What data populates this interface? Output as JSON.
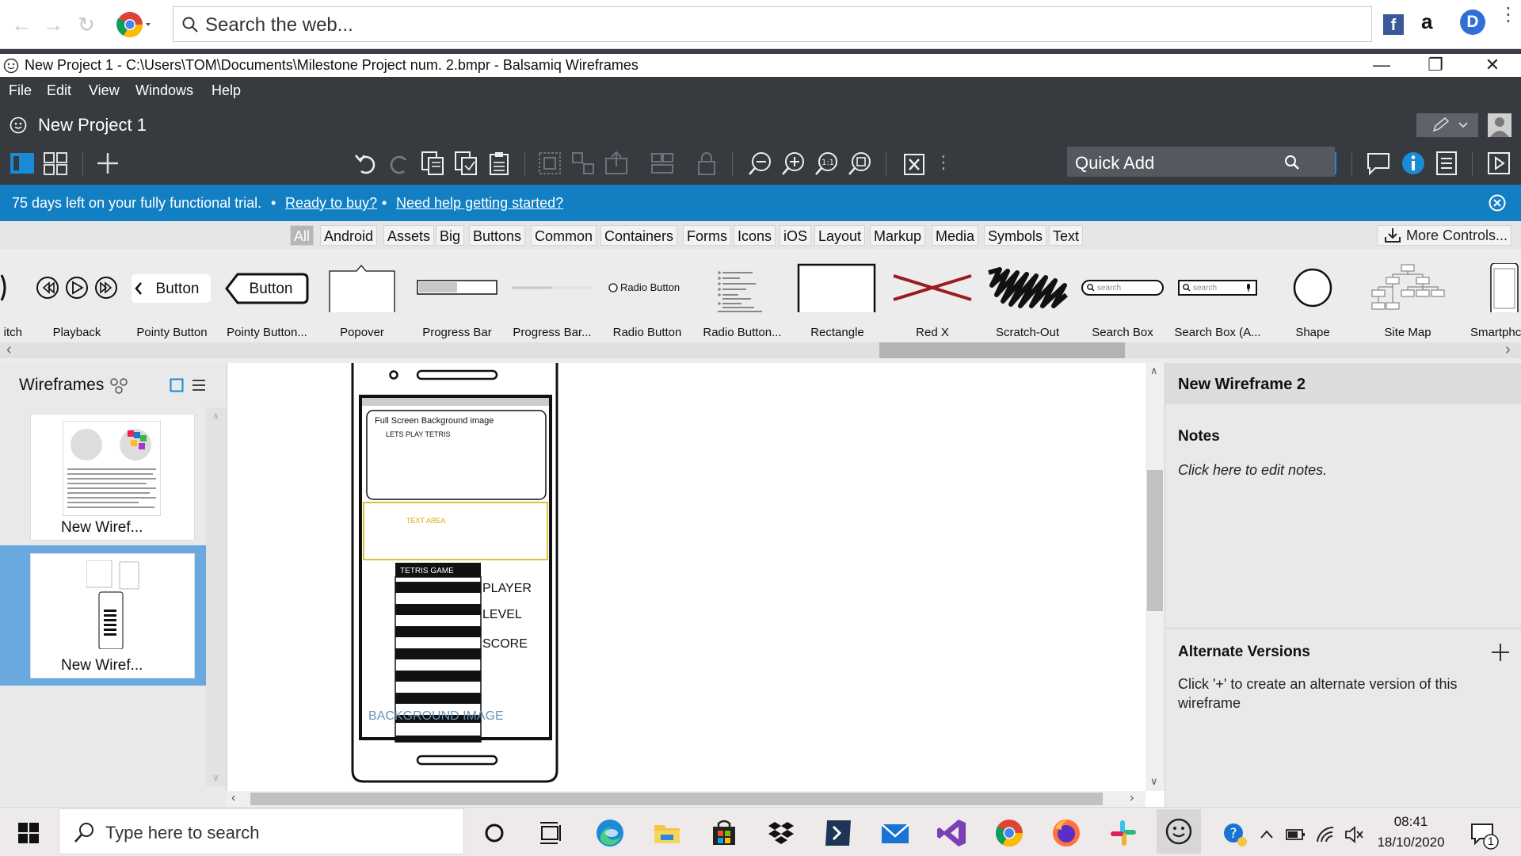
{
  "browser": {
    "search_placeholder": "Search the web...",
    "extension_icons": [
      "facebook-icon",
      "amazon-icon",
      "profile-d-icon",
      "kebab-menu-icon"
    ]
  },
  "window": {
    "title": "New Project 1 - C:\\Users\\TOM\\Documents\\Milestone Project num. 2.bmpr - Balsamiq Wireframes",
    "controls": [
      "minimize",
      "restore",
      "close"
    ]
  },
  "menu": {
    "items": [
      "File",
      "Edit",
      "View",
      "Windows",
      "Help"
    ]
  },
  "project": {
    "name": "New Project 1"
  },
  "toolbar": {
    "quick_add_placeholder": "Quick Add"
  },
  "trial_banner": {
    "message": "75 days left on your fully functional trial.",
    "bullet": "•",
    "link_buy": "Ready to buy?",
    "link_help": "Need help getting started?"
  },
  "library_tabs": {
    "items": [
      "All",
      "Android",
      "Assets",
      "Big",
      "Buttons",
      "Common",
      "Containers",
      "Forms",
      "Icons",
      "iOS",
      "Layout",
      "Markup",
      "Media",
      "Symbols",
      "Text"
    ],
    "active": "All",
    "more_controls": "More Controls..."
  },
  "components": {
    "items": [
      {
        "label": "itch"
      },
      {
        "label": "Playback"
      },
      {
        "label": "Pointy Button",
        "sample": "Button"
      },
      {
        "label": "Pointy Button...",
        "sample": "Button"
      },
      {
        "label": "Popover"
      },
      {
        "label": "Progress Bar"
      },
      {
        "label": "Progress Bar..."
      },
      {
        "label": "Radio Button",
        "sample": "Radio Button"
      },
      {
        "label": "Radio Button..."
      },
      {
        "label": "Rectangle"
      },
      {
        "label": "Red X"
      },
      {
        "label": "Scratch-Out"
      },
      {
        "label": "Search Box",
        "sample": "search"
      },
      {
        "label": "Search Box (A...",
        "sample": "search"
      },
      {
        "label": "Shape"
      },
      {
        "label": "Site Map"
      },
      {
        "label": "Smartphc"
      }
    ]
  },
  "wireframes_panel": {
    "title": "Wireframes",
    "items": [
      {
        "label": "New Wiref...",
        "selected": false
      },
      {
        "label": "New Wiref...",
        "selected": true
      }
    ]
  },
  "mockup": {
    "bg_label": "Full Screen Background image",
    "play_label": "LETS PLAY TETRIS",
    "text_area": "TEXT  AREA",
    "game_title": "TETRIS GAME",
    "stats": [
      "PLAYER",
      "LEVEL",
      "SCORE"
    ],
    "footer": "BACKGROUND  IMAGE"
  },
  "inspector": {
    "title": "New Wireframe 2",
    "notes_heading": "Notes",
    "notes_placeholder": "Click here to edit notes.",
    "alt_heading": "Alternate Versions",
    "alt_text": "Click '+' to create an alternate version of this wireframe"
  },
  "taskbar": {
    "search_placeholder": "Type here to search",
    "time": "08:41",
    "date": "18/10/2020",
    "notification_count": "1"
  }
}
